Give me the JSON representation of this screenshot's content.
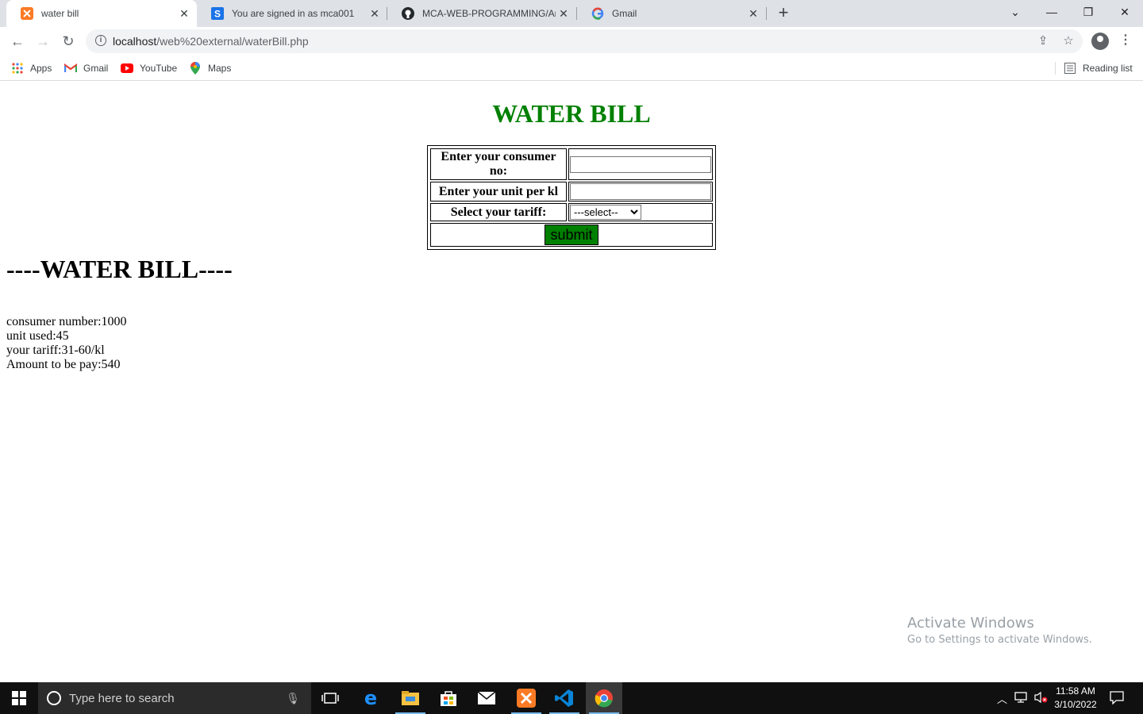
{
  "browser": {
    "tabs": [
      {
        "title": "water bill",
        "active": true,
        "icon": "xampp-icon"
      },
      {
        "title": "You are signed in as mca001",
        "active": false,
        "icon": "s-icon"
      },
      {
        "title": "MCA-WEB-PROGRAMMING/Arju",
        "active": false,
        "icon": "github-icon"
      },
      {
        "title": "Gmail",
        "active": false,
        "icon": "google-icon"
      }
    ],
    "url_host": "localhost",
    "url_path": "/web%20external/waterBill.php",
    "bookmarks": [
      "Apps",
      "Gmail",
      "YouTube",
      "Maps"
    ],
    "reading_list": "Reading list"
  },
  "page": {
    "title": "WATER BILL",
    "form": {
      "consumer_label": "Enter your consumer no:",
      "unit_label": "Enter your unit per kl",
      "tariff_label": "Select your tariff:",
      "tariff_selected": "---select--",
      "submit_label": "submit"
    },
    "bill": {
      "heading": "----WATER BILL----",
      "lines": [
        "consumer number:1000",
        "unit used:45",
        "your tariff:31-60/kl",
        "Amount to be pay:540"
      ]
    }
  },
  "watermark": {
    "line1": "Activate Windows",
    "line2": "Go to Settings to activate Windows."
  },
  "taskbar": {
    "search_placeholder": "Type here to search",
    "time": "11:58 AM",
    "date": "3/10/2022"
  },
  "colors": {
    "title_green": "#008000",
    "button_green": "#008000",
    "taskbar_bg": "#101010"
  }
}
